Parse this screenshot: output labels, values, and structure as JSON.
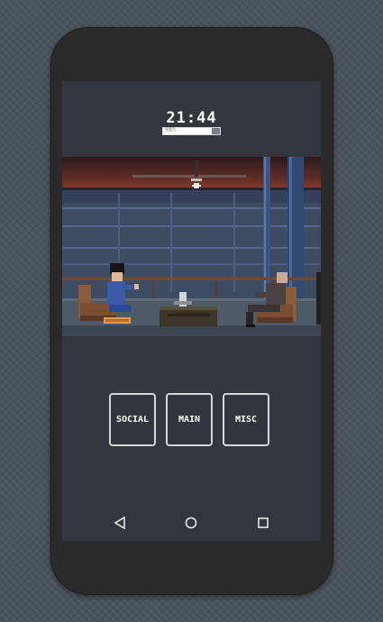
{
  "status": {
    "clock": "21:44",
    "energy_label": "86%",
    "energy_level": 0.86
  },
  "menu": {
    "social_label": "SOCIAL",
    "main_label": "MAIN",
    "misc_label": "MISC"
  },
  "nav": {
    "back_icon": "back-triangle-icon",
    "home_icon": "home-circle-icon",
    "recents_icon": "recents-square-icon"
  },
  "colors": {
    "sky_top": "#3a1f1f",
    "scene_wall": "#3f5068",
    "floor": "#4f5a68",
    "button_border": "#d6d6d6"
  }
}
